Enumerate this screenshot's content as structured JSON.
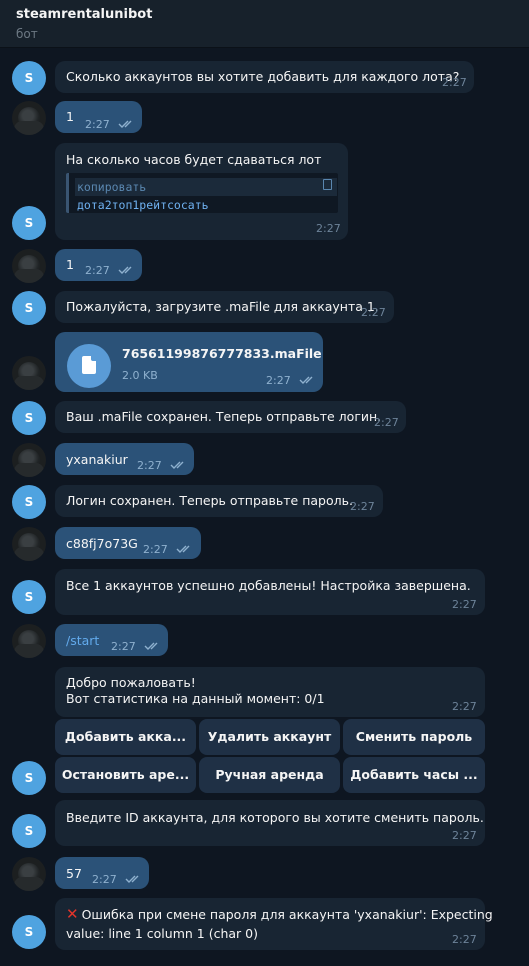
{
  "header": {
    "title": "steamrentalunibot",
    "subtitle": "бот"
  },
  "avatar_letter": "S",
  "messages": {
    "m1": {
      "text": "Сколько аккаунтов вы хотите добавить для каждого лота?",
      "time": "2:27"
    },
    "m2": {
      "text": "1",
      "time": "2:27"
    },
    "m3": {
      "text": "На сколько часов будет сдаваться лот",
      "code_lang": "копировать",
      "code_body": "дота2топ1рейтсосать",
      "time": "2:27"
    },
    "m4": {
      "text": "1",
      "time": "2:27"
    },
    "m5": {
      "text": "Пожалуйста, загрузите .maFile для аккаунта 1.",
      "time": "2:27"
    },
    "m6": {
      "file_name": "76561199876777833.maFile",
      "file_size": "2.0 KB",
      "time": "2:27"
    },
    "m7": {
      "text": "Ваш .maFile сохранен. Теперь отправьте логин.",
      "time": "2:27"
    },
    "m8": {
      "text": "yxanakiur",
      "time": "2:27"
    },
    "m9": {
      "text": "Логин сохранен. Теперь отправьте пароль.",
      "time": "2:27"
    },
    "m10": {
      "text": "c88fj7o73G",
      "time": "2:27"
    },
    "m11": {
      "text": "Все 1 аккаунтов успешно добавлены! Настройка завершена.",
      "time": "2:27"
    },
    "m12": {
      "text": "/start",
      "time": "2:27"
    },
    "m13": {
      "line1": "Добро пожаловать!",
      "line2": "Вот статистика на данный момент: 0/1",
      "time": "2:27"
    },
    "m14": {
      "text": "Введите ID аккаунта, для которого вы хотите сменить пароль.",
      "time": "2:27"
    },
    "m15": {
      "text": "57",
      "time": "2:27"
    },
    "m16": {
      "line1": "Ошибка при смене пароля для аккаунта 'yxanakiur': Expecting",
      "line2": "value: line 1 column 1 (char 0)",
      "time": "2:27"
    }
  },
  "keyboard": [
    "Добавить акка...",
    "Удалить аккаунт",
    "Сменить пароль",
    "Остановить аре...",
    "Ручная аренда",
    "Добавить часы ..."
  ],
  "colors": {
    "background": "#0e1621",
    "incoming": "#182533",
    "outgoing": "#2b5278",
    "accent": "#4fa3e0",
    "error": "#e0342b"
  }
}
